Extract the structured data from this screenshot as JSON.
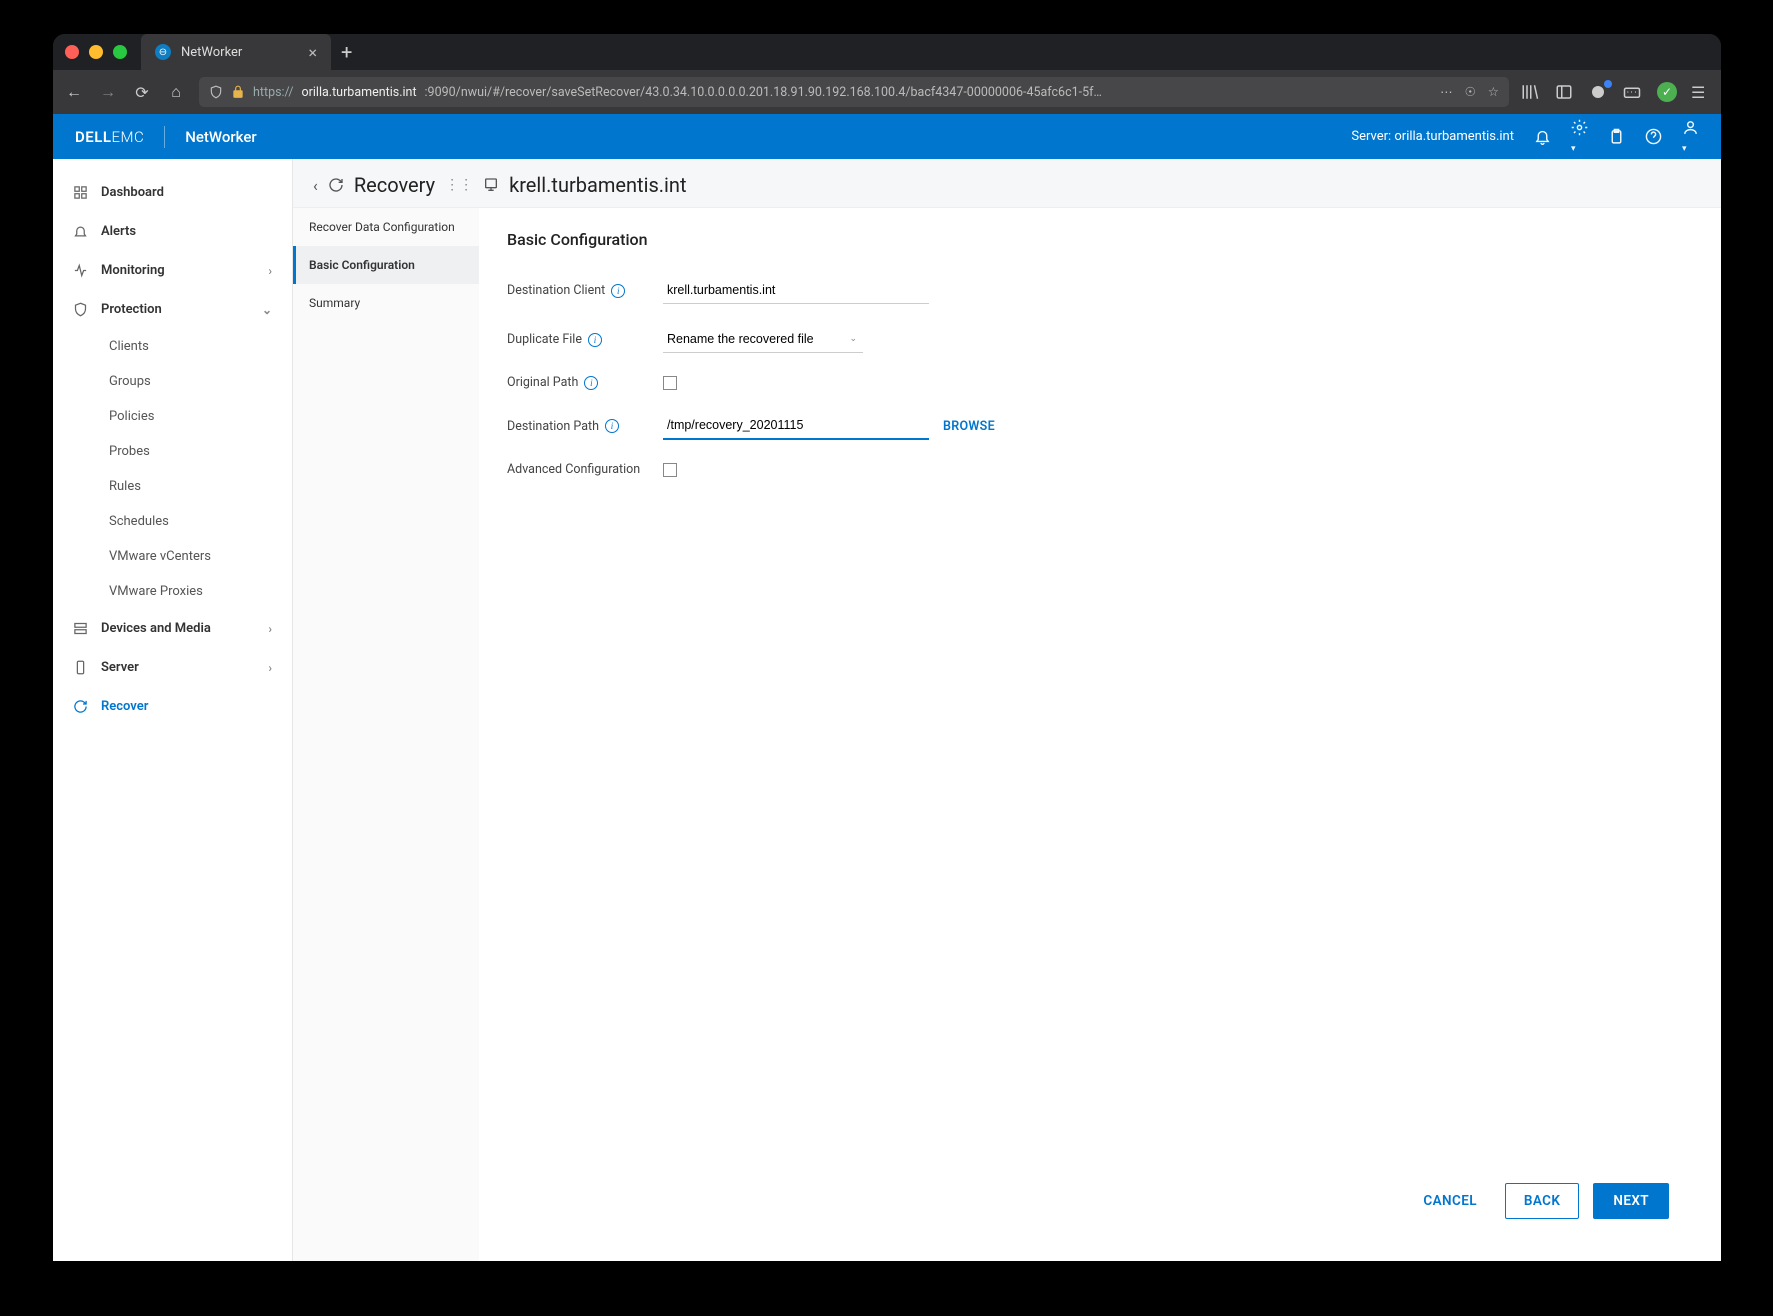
{
  "browser": {
    "tab_title": "NetWorker",
    "url_proto": "https://",
    "url_host": "orilla.turbamentis.int",
    "url_path": ":9090/nwui/#/recover/saveSetRecover/43.0.34.10.0.0.0.0.201.18.91.90.192.168.100.4/bacf4347-00000006-45afc6c1-5f…"
  },
  "app": {
    "brand": "DELL",
    "brand2": "EMC",
    "product": "NetWorker",
    "server_label": "Server:",
    "server_value": "orilla.turbamentis.int"
  },
  "sidebar": {
    "items": [
      {
        "label": "Dashboard"
      },
      {
        "label": "Alerts"
      },
      {
        "label": "Monitoring"
      },
      {
        "label": "Protection"
      },
      {
        "label": "Devices and Media"
      },
      {
        "label": "Server"
      },
      {
        "label": "Recover"
      }
    ],
    "protection_children": [
      {
        "label": "Clients"
      },
      {
        "label": "Groups"
      },
      {
        "label": "Policies"
      },
      {
        "label": "Probes"
      },
      {
        "label": "Rules"
      },
      {
        "label": "Schedules"
      },
      {
        "label": "VMware vCenters"
      },
      {
        "label": "VMware Proxies"
      }
    ]
  },
  "crumb": {
    "root": "Recovery",
    "host": "krell.turbamentis.int"
  },
  "steps": [
    {
      "label": "Recover Data Configuration"
    },
    {
      "label": "Basic Configuration"
    },
    {
      "label": "Summary"
    }
  ],
  "form": {
    "title": "Basic Configuration",
    "dest_client_label": "Destination Client",
    "dest_client_value": "krell.turbamentis.int",
    "dup_file_label": "Duplicate File",
    "dup_file_value": "Rename the recovered file",
    "orig_path_label": "Original Path",
    "dest_path_label": "Destination Path",
    "dest_path_value": "/tmp/recovery_20201115",
    "browse": "BROWSE",
    "adv_label": "Advanced Configuration"
  },
  "footer": {
    "cancel": "CANCEL",
    "back": "BACK",
    "next": "NEXT"
  }
}
